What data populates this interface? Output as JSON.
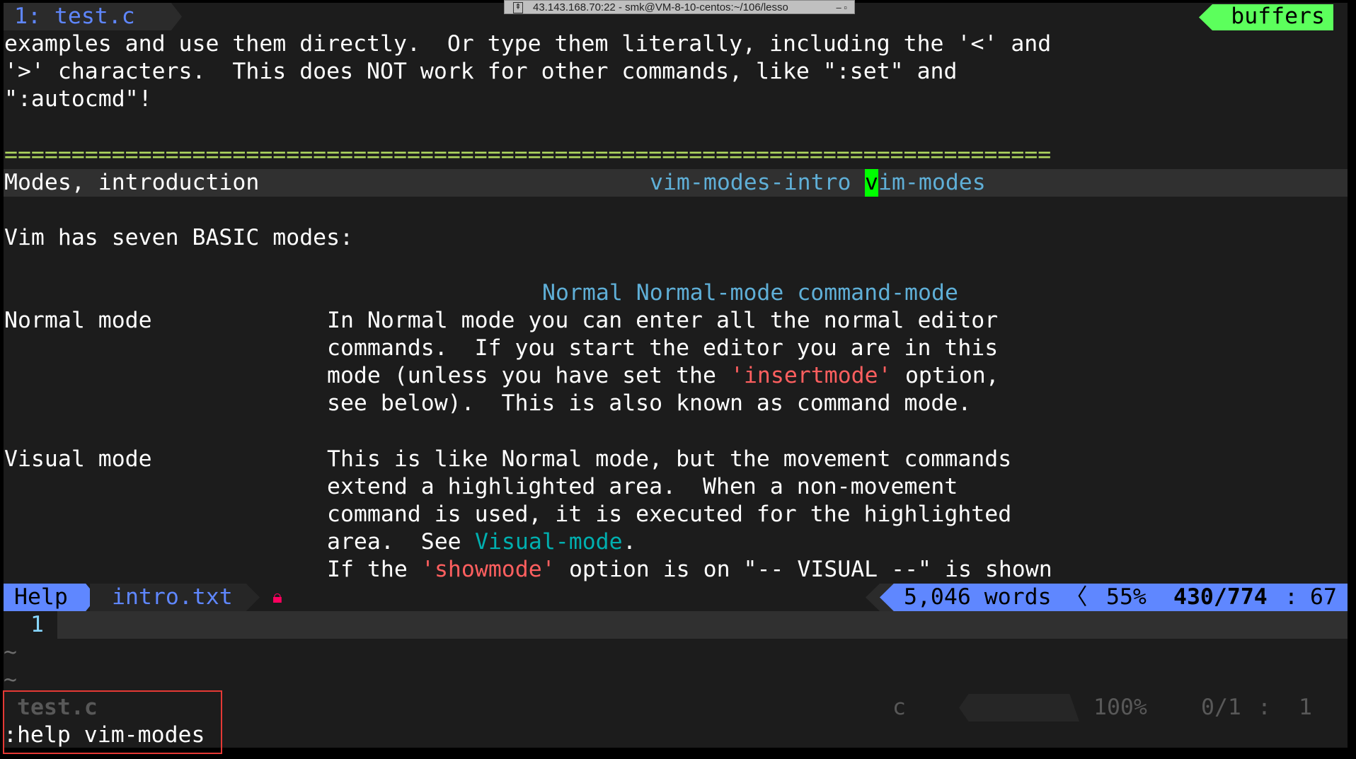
{
  "window_title": "43.143.168.70:22 - smk@VM-8-10-centos:~/106/lesso",
  "colors": {
    "text": "#ffffff",
    "tag": "#5fafd7",
    "option": "#ff5f5f",
    "link": "#00afaf",
    "separator": "#afd75f",
    "cursor": "#00ff00",
    "status_accent": "#5f87ff",
    "buffers_badge": "#5cff5c",
    "lock": "#ff005f"
  },
  "tabline": {
    "tab_label": "1: test.c",
    "buffers_label": "buffers"
  },
  "lines": [
    [
      {
        "col": 0,
        "t": "examples and use them directly.  Or type them literally, including the '<' and",
        "c": "text"
      }
    ],
    [
      {
        "col": 0,
        "t": "'>' characters.  This does NOT work for other commands, like \":set\" and",
        "c": "text"
      }
    ],
    [
      {
        "col": 0,
        "t": "\":autocmd\"!",
        "c": "text"
      }
    ],
    [],
    [
      {
        "col": 0,
        "t": "==============================================================================",
        "c": "separator"
      }
    ],
    [
      {
        "col": 0,
        "t": "Modes, introduction",
        "c": "text"
      },
      {
        "col": 48,
        "t": "vim-modes-intro",
        "c": "tag"
      },
      {
        "col": 64,
        "t": "v",
        "c": "cursor"
      },
      {
        "col": 65,
        "t": "im-modes",
        "c": "tag"
      }
    ],
    [],
    [
      {
        "col": 0,
        "t": "Vim has seven BASIC modes:",
        "c": "text"
      }
    ],
    [],
    [
      {
        "col": 40,
        "t": "Normal Normal-mode command-mode",
        "c": "tag"
      }
    ],
    [
      {
        "col": 0,
        "t": "Normal mode",
        "c": "text"
      },
      {
        "col": 24,
        "t": "In Normal mode you can enter all the normal editor",
        "c": "text"
      }
    ],
    [
      {
        "col": 24,
        "t": "commands.  If you start the editor you are in this",
        "c": "text"
      }
    ],
    [
      {
        "col": 24,
        "t": "mode (unless you have set the ",
        "c": "text"
      },
      {
        "col": 54,
        "t": "'insertmode'",
        "c": "option"
      },
      {
        "col": 66,
        "t": " option,",
        "c": "text"
      }
    ],
    [
      {
        "col": 24,
        "t": "see below).  This is also known as command mode.",
        "c": "text"
      }
    ],
    [],
    [
      {
        "col": 0,
        "t": "Visual mode",
        "c": "text"
      },
      {
        "col": 24,
        "t": "This is like Normal mode, but the movement commands",
        "c": "text"
      }
    ],
    [
      {
        "col": 24,
        "t": "extend a highlighted area.  When a non-movement",
        "c": "text"
      }
    ],
    [
      {
        "col": 24,
        "t": "command is used, it is executed for the highlighted",
        "c": "text"
      }
    ],
    [
      {
        "col": 24,
        "t": "area.  See ",
        "c": "text"
      },
      {
        "col": 35,
        "t": "Visual-mode",
        "c": "link"
      },
      {
        "col": 46,
        "t": ".",
        "c": "text"
      }
    ],
    [
      {
        "col": 24,
        "t": "If the ",
        "c": "text"
      },
      {
        "col": 31,
        "t": "'showmode'",
        "c": "option"
      },
      {
        "col": 41,
        "t": " option is on \"-- VISUAL --\" is shown",
        "c": "text"
      }
    ]
  ],
  "statusline": {
    "mode": "Help",
    "filename": "intro.txt",
    "lock_icon": "lock-icon",
    "words": "5,046 words",
    "percent": "55%",
    "position": "430/774",
    "column": "67"
  },
  "cmdwin": {
    "line_number": "1",
    "tilde1": "~",
    "tilde2": "~"
  },
  "inactive_status": {
    "filename": "test.c",
    "filetype": "c",
    "percent": "100%",
    "position": "0/1",
    "column": "1"
  },
  "cmdline": ":help vim-modes"
}
